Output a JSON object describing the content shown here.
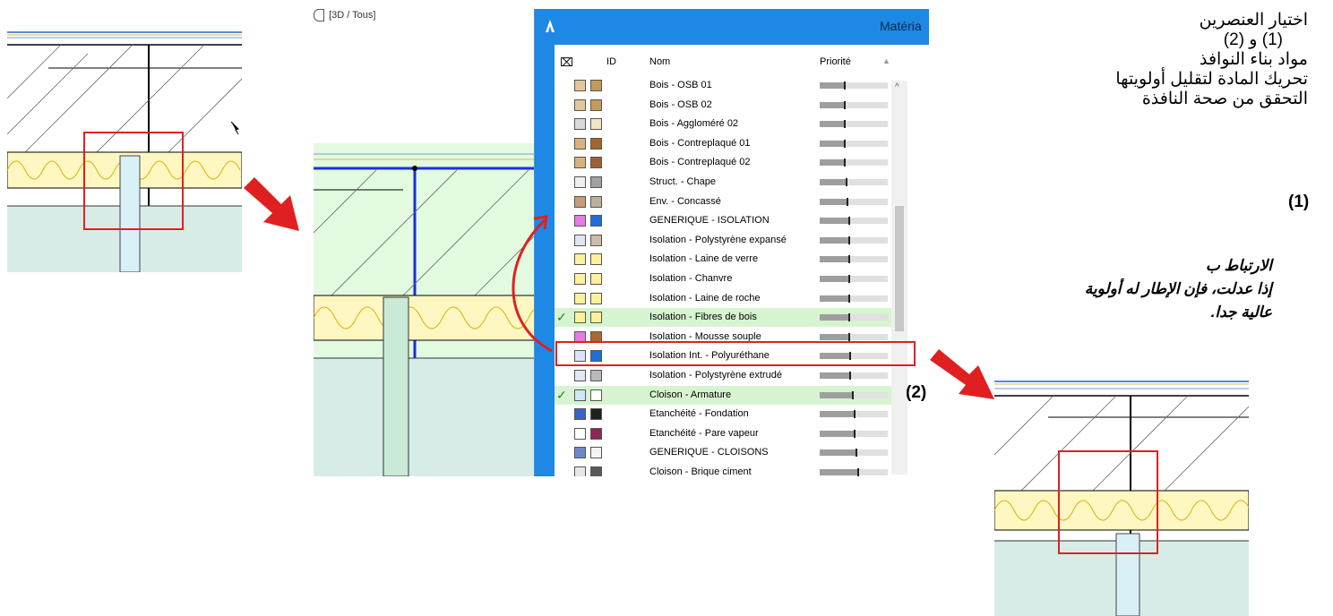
{
  "view_tab": "[3D / Tous]",
  "dialog": {
    "title": "Matéria",
    "columns": {
      "id": "ID",
      "name": "Nom",
      "priority": "Priorité"
    },
    "rows": [
      {
        "name": "Bois - OSB 01",
        "c1": "#e3c79a",
        "c2": "#c49a5a",
        "checked": false,
        "p": 0.35
      },
      {
        "name": "Bois - OSB 02",
        "c1": "#e3c79a",
        "c2": "#c49a5a",
        "checked": false,
        "p": 0.35
      },
      {
        "name": "Bois - Aggloméré 02",
        "c1": "#d9d9d9",
        "c2": "#f3e3c4",
        "checked": false,
        "p": 0.35
      },
      {
        "name": "Bois - Contreplaqué 01",
        "c1": "#d9b27c",
        "c2": "#a5652a",
        "checked": false,
        "p": 0.35
      },
      {
        "name": "Bois - Contreplaqué 02",
        "c1": "#d9b27c",
        "c2": "#9c6232",
        "checked": false,
        "p": 0.35
      },
      {
        "name": "Struct. - Chape",
        "c1": "#eeeeee",
        "c2": "#a0a0a0",
        "checked": false,
        "p": 0.38
      },
      {
        "name": "Env. - Concassé",
        "c1": "#c79d78",
        "c2": "#bcb09c",
        "checked": false,
        "p": 0.4
      },
      {
        "name": "GENERIQUE - ISOLATION",
        "c1": "#e57ce5",
        "c2": "#1e6fd9",
        "checked": false,
        "p": 0.42
      },
      {
        "name": "Isolation - Polystyrène expansé",
        "c1": "#dde4f3",
        "c2": "#c9bca9",
        "checked": false,
        "p": 0.42
      },
      {
        "name": "Isolation - Laine de verre",
        "c1": "#fff19a",
        "c2": "#fff19a",
        "checked": false,
        "p": 0.42
      },
      {
        "name": "Isolation - Chanvre",
        "c1": "#fff19a",
        "c2": "#fff19a",
        "checked": false,
        "p": 0.42
      },
      {
        "name": "Isolation - Laine de roche",
        "c1": "#fff19a",
        "c2": "#fff19a",
        "checked": false,
        "p": 0.42
      },
      {
        "name": "Isolation - Fibres de bois",
        "c1": "#fff19a",
        "c2": "#fff19a",
        "checked": true,
        "p": 0.42
      },
      {
        "name": "Isolation - Mousse souple",
        "c1": "#e57ce5",
        "c2": "#a86b2d",
        "checked": false,
        "p": 0.42
      },
      {
        "name": "Isolation Int. - Polyuréthane",
        "c1": "#dbe4f6",
        "c2": "#1e6fd9",
        "checked": false,
        "p": 0.44
      },
      {
        "name": "Isolation - Polystyrène extrudé",
        "c1": "#e3e6f3",
        "c2": "#b9b9b9",
        "checked": false,
        "p": 0.44
      },
      {
        "name": "Cloison - Armature",
        "c1": "#cfe9f2",
        "c2": "#ffffff",
        "checked": true,
        "p": 0.48
      },
      {
        "name": "Etanchéité - Fondation",
        "c1": "#3a62c8",
        "c2": "#202020",
        "checked": false,
        "p": 0.5
      },
      {
        "name": "Etanchéité - Pare vapeur",
        "c1": "#ffffff",
        "c2": "#8e2557",
        "checked": false,
        "p": 0.5
      },
      {
        "name": "GENERIQUE - CLOISONS",
        "c1": "#6d88c9",
        "c2": "#f3f3f3",
        "checked": false,
        "p": 0.52
      },
      {
        "name": "Cloison - Brique ciment",
        "c1": "#e6e6e6",
        "c2": "#5a5a5a",
        "checked": false,
        "p": 0.55
      }
    ]
  },
  "labels": {
    "one": "(1)",
    "two": "(2)"
  },
  "instructions": [
    "اختيار العنصرين",
    "(1) و (2)",
    "مواد بناء النوافذ",
    "تحريك المادة لتقليل أولويتها",
    "التحقق من صحة النافذة"
  ],
  "note": [
    "الارتباط ب",
    "إذا عدلت، فإن الإطار له أولوية",
    "عالية جدا."
  ],
  "colors": {
    "accent_red": "#e02020",
    "dialog_blue": "#1e88e5",
    "selected_row": "#d7f4d0",
    "insulation_yellow": "#fff7c2",
    "glazing_blue": "#d9f0f7"
  }
}
